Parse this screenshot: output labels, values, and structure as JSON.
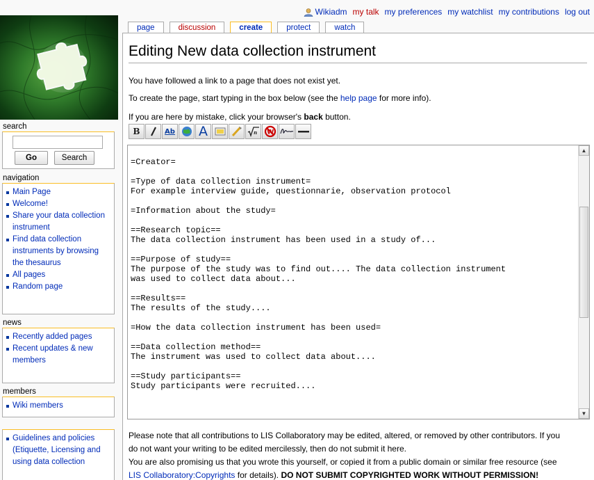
{
  "personal": {
    "username": "Wikiadm",
    "mytalk": "my talk",
    "preferences": "my preferences",
    "watchlist": "my watchlist",
    "contributions": "my contributions",
    "logout": "log out"
  },
  "tabs": [
    {
      "label": "page"
    },
    {
      "label": "discussion"
    },
    {
      "label": "create"
    },
    {
      "label": "protect"
    },
    {
      "label": "watch"
    }
  ],
  "heading": "Editing New data collection instrument",
  "intro": {
    "line1": "You have followed a link to a page that does not exist yet.",
    "line2_pre": "To create the page, start typing in the box below (see the ",
    "line2_link": "help page",
    "line2_post": " for more info).",
    "line3_pre": "If you are here by mistake, click your browser's ",
    "line3_bold": "back",
    "line3_post": " button."
  },
  "toolbar_icons": [
    "bold-icon",
    "italic-icon",
    "internal-link-icon",
    "external-link-icon",
    "headline-icon",
    "image-icon",
    "media-icon",
    "math-icon",
    "nowiki-icon",
    "signature-icon",
    "horizontal-line-icon"
  ],
  "editor": {
    "text": "=Creator=\n\n=Type of data collection instrument=\nFor example interview guide, questionnarie, observation protocol\n\n=Information about the study=\n\n==Research topic==\nThe data collection instrument has been used in a study of...\n\n==Purpose of study==\nThe purpose of the study was to find out.... The data collection instrument\nwas used to collect data about...\n\n==Results==\nThe results of the study....\n\n=How the data collection instrument has been used=\n\n==Data collection method==\nThe instrument was used to collect data about....\n\n==Study participants==\nStudy participants were recruited...."
  },
  "warning": {
    "line1": "Please note that all contributions to LIS Collaboratory may be edited, altered, or removed by other contributors. If you",
    "line2": "do not want your writing to be edited mercilessly, then do not submit it here.",
    "line3": "You are also promising us that you wrote this yourself, or copied it from a public domain or similar free resource (see",
    "line4_link": "LIS Collaboratory:Copyrights",
    "line4_mid": " for details). ",
    "line4_bold": "DO NOT SUBMIT COPYRIGHTED WORK WITHOUT PERMISSION!"
  },
  "sidebar": {
    "search": {
      "title": "search",
      "go_label": "Go",
      "search_label": "Search"
    },
    "navigation": {
      "title": "navigation",
      "items": [
        "Main Page",
        "Welcome!",
        "Share your data collection instrument",
        "Find data collection instruments by browsing the thesaurus",
        "All pages",
        "Random page"
      ]
    },
    "news": {
      "title": "news",
      "items": [
        "Recently added pages",
        "Recent updates & new members"
      ]
    },
    "members": {
      "title": "members",
      "items": [
        "Wiki members"
      ]
    },
    "guidelines": {
      "items": [
        "Guidelines and policies (Etiquette, Licensing and using data collection"
      ]
    }
  },
  "colors": {
    "link": "#002bb8",
    "new_link": "#ba0000",
    "selected_tab_border": "#fabd23"
  }
}
